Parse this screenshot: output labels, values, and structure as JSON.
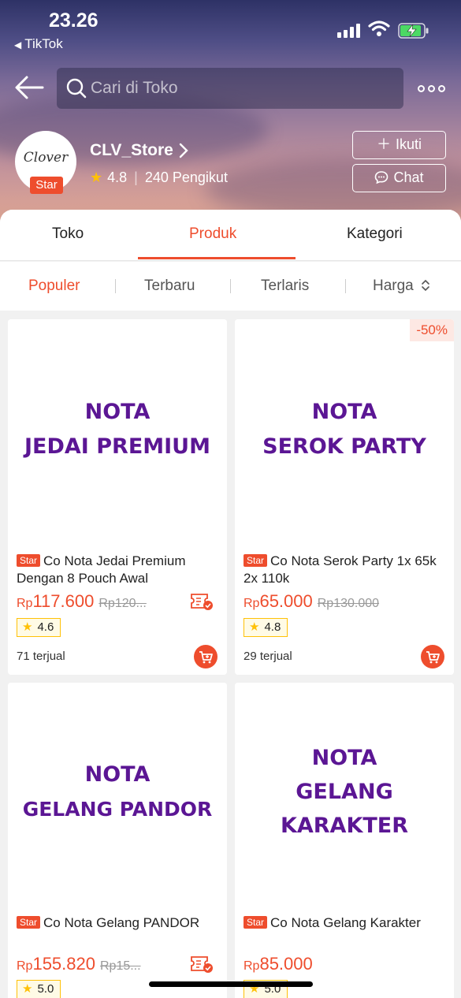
{
  "status_bar": {
    "time": "23.26",
    "back_app": "TikTok"
  },
  "search": {
    "placeholder": "Cari di Toko"
  },
  "store": {
    "name": "CLV_Store",
    "logo_text": "Clover",
    "badge": "Star",
    "rating": "4.8",
    "followers": "240 Pengikut",
    "follow_label": "Ikuti",
    "chat_label": "Chat"
  },
  "tabs": [
    {
      "label": "Toko",
      "active": false
    },
    {
      "label": "Produk",
      "active": true
    },
    {
      "label": "Kategori",
      "active": false
    }
  ],
  "sort": {
    "options": [
      "Populer",
      "Terbaru",
      "Terlaris",
      "Harga"
    ],
    "active": "Populer"
  },
  "products": [
    {
      "image_text_1": "NOTA",
      "image_text_2": "JEDAI PREMIUM",
      "image_text_3": "",
      "badge": "Star",
      "title": "Co Nota Jedai Premium Dengan 8 Pouch Awal",
      "price": "117.600",
      "old_price": "Rp120...",
      "rating": "4.6",
      "sold": "71 terjual"
    },
    {
      "image_text_1": "NOTA",
      "image_text_2": "SEROK PARTY",
      "image_text_3": "",
      "discount": "-50%",
      "badge": "Star",
      "title": "Co Nota Serok Party 1x 65k 2x 110k",
      "price": "65.000",
      "old_price": "Rp130.000",
      "rating": "4.8",
      "sold": "29 terjual"
    },
    {
      "image_text_1": "NOTA",
      "image_text_2": "GELANG PANDOR",
      "image_text_3": "",
      "badge": "Star",
      "title": "Co Nota Gelang PANDOR",
      "price": "155.820",
      "old_price": "Rp15...",
      "rating": "5.0"
    },
    {
      "image_text_1": "NOTA",
      "image_text_2": "GELANG",
      "image_text_3": "KARAKTER",
      "badge": "Star",
      "title": "Co Nota Gelang Karakter",
      "price": "85.000",
      "old_price": "",
      "rating": "5.0"
    }
  ],
  "currency": "Rp",
  "colors": {
    "accent": "#ee4d2d",
    "image_text": "#5b1694",
    "rating_star": "#ffc107"
  }
}
